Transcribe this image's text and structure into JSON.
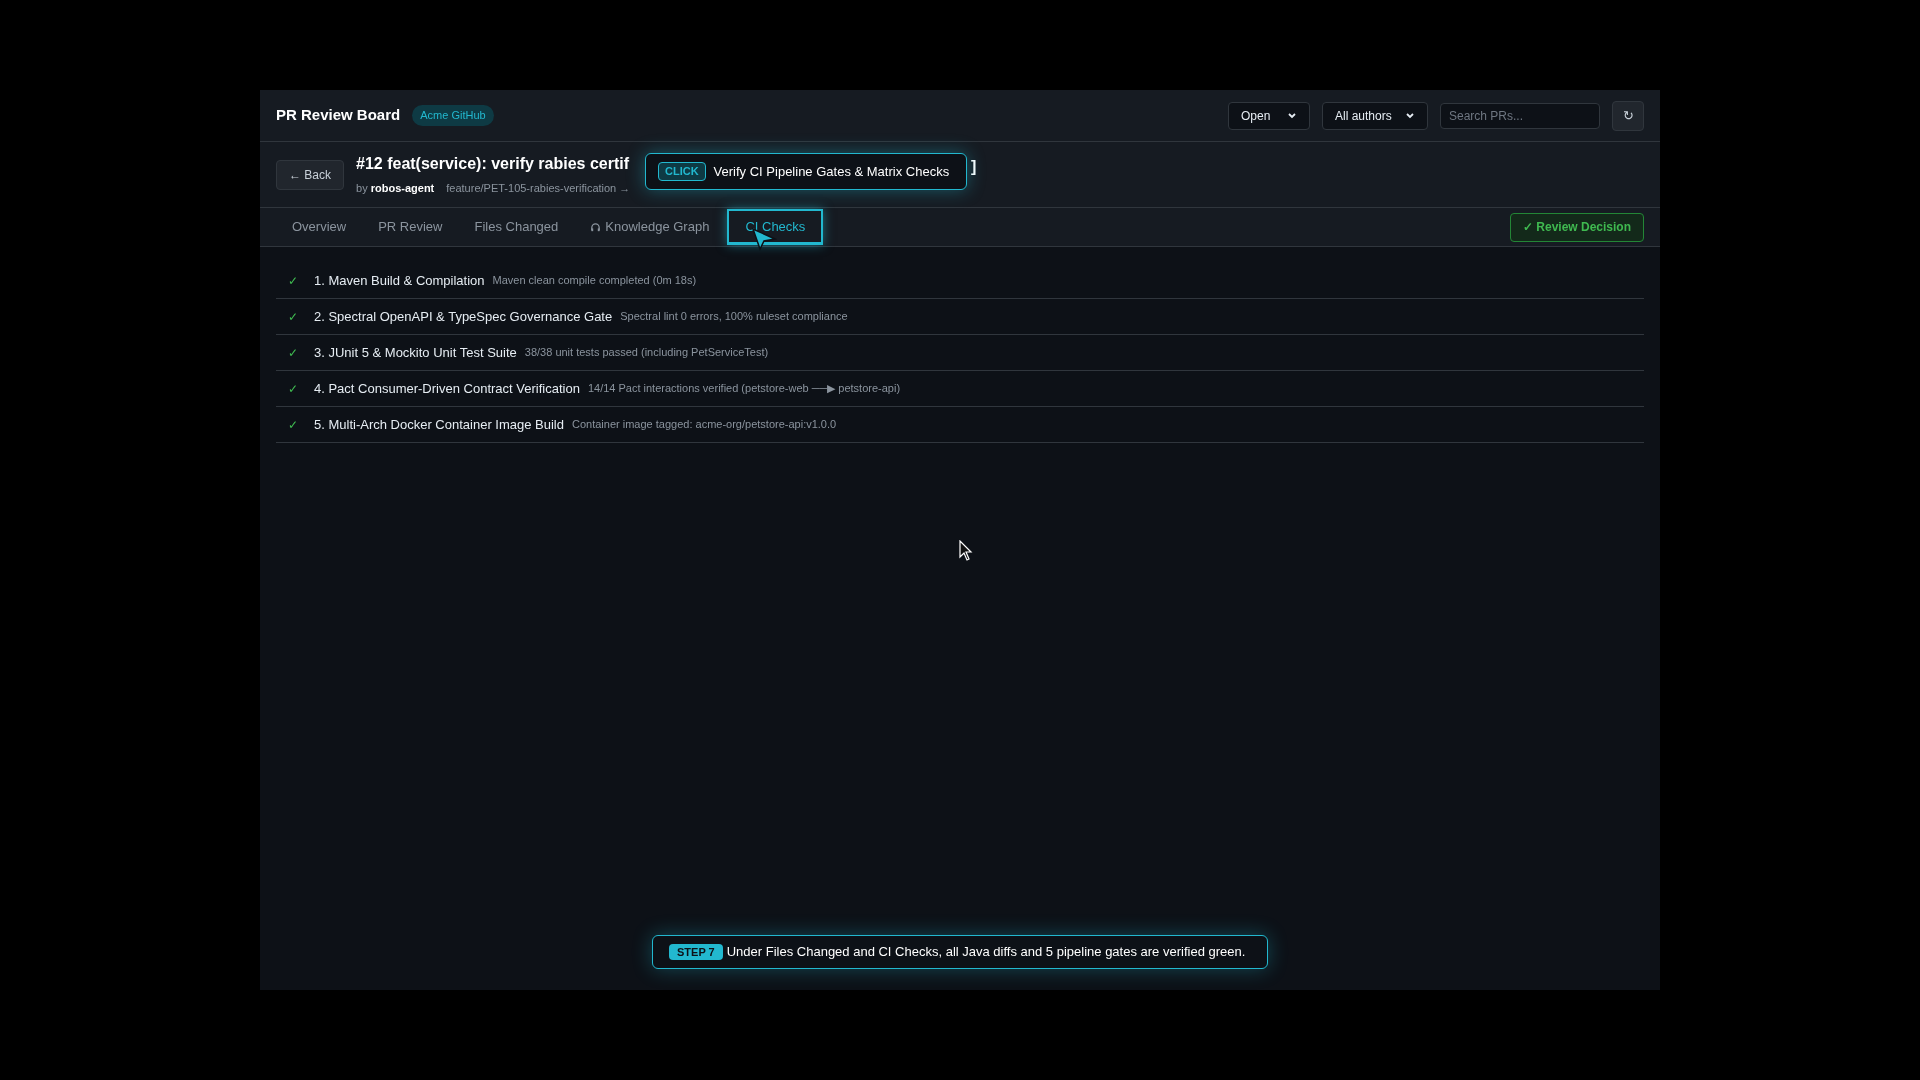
{
  "header": {
    "title": "PR Review Board",
    "org_badge": "Acme GitHub",
    "status_filter": "Open",
    "author_filter": "All authors",
    "search": {
      "placeholder": "Search PRs..."
    },
    "refresh_button": "↻"
  },
  "pr": {
    "back_button": "← Back",
    "title_start": "#12 feat(service): verify rabies certif",
    "title_end": "]",
    "by_label": "by",
    "author": "robos-agent",
    "branch": "feature/PET-105-rabies-verification →"
  },
  "tooltip": {
    "badge": "CLICK",
    "text": "Verify CI Pipeline Gates & Matrix Checks"
  },
  "tabs": [
    {
      "label": "Overview",
      "selected": false
    },
    {
      "label": "PR Review",
      "selected": false
    },
    {
      "label": "Files Changed",
      "selected": false
    },
    {
      "label": "Knowledge Graph",
      "selected": false,
      "kind": "graph"
    },
    {
      "label": "CI Checks",
      "selected": true
    }
  ],
  "review_button": "✓ Review Decision",
  "checks": [
    {
      "name": "1. Maven Build & Compilation",
      "detail": "Maven clean compile completed (0m 18s)",
      "passed": true,
      "status_icon": "✓"
    },
    {
      "name": "2. Spectral OpenAPI & TypeSpec Governance Gate",
      "detail": "Spectral lint 0 errors, 100% ruleset compliance",
      "passed": true,
      "status_icon": "✓"
    },
    {
      "name": "3. JUnit 5 & Mockito Unit Test Suite",
      "detail": "38/38 unit tests passed (including PetServiceTest)",
      "passed": true,
      "status_icon": "✓"
    },
    {
      "name": "4. Pact Consumer-Driven Contract Verification",
      "detail": "14/14 Pact interactions verified (petstore-web ──▶ petstore-api)",
      "passed": true,
      "status_icon": "✓"
    },
    {
      "name": "5. Multi-Arch Docker Container Image Build",
      "detail": "Container image tagged: acme-org/petstore-api:v1.0.0",
      "passed": true,
      "status_icon": "✓"
    }
  ],
  "step_banner": {
    "badge": "STEP 7",
    "text": "Under Files Changed and CI Checks, all Java diffs and 5 pipeline gates are verified green."
  }
}
